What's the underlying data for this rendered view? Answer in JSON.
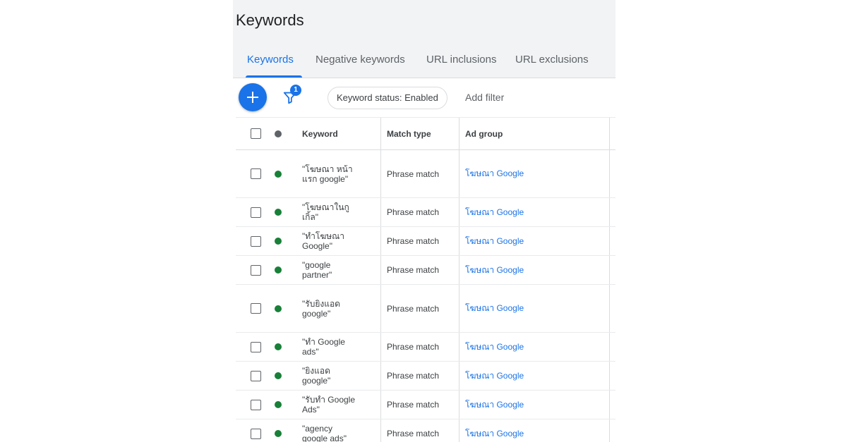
{
  "header": {
    "title": "Keywords",
    "tabs": [
      {
        "label": "Keywords",
        "active": true
      },
      {
        "label": "Negative keywords",
        "active": false
      },
      {
        "label": "URL inclusions",
        "active": false
      },
      {
        "label": "URL exclusions",
        "active": false
      }
    ]
  },
  "toolbar": {
    "add_icon": "plus-icon",
    "filter_icon": "filter-icon",
    "filter_count": "1",
    "status_chip": "Keyword status: Enabled",
    "add_filter": "Add filter"
  },
  "table": {
    "columns": [
      "Keyword",
      "Match type",
      "Ad group"
    ],
    "status_header_color": "#5f6368",
    "enabled_color": "#188038",
    "rows": [
      {
        "keyword_line1": "\"โฆษณา หน้า",
        "keyword_line2": "แรก google\"",
        "match_type": "Phrase match",
        "ad_group": "โฆษณา Google"
      },
      {
        "keyword_line1": "\"โฆษณาในกู",
        "keyword_line2": "เกิ้ล\"",
        "match_type": "Phrase match",
        "ad_group": "โฆษณา Google"
      },
      {
        "keyword_line1": "\"ทำโฆษณา",
        "keyword_line2": "Google\"",
        "match_type": "Phrase match",
        "ad_group": "โฆษณา Google"
      },
      {
        "keyword_line1": "\"google",
        "keyword_line2": "partner\"",
        "match_type": "Phrase match",
        "ad_group": "โฆษณา Google"
      },
      {
        "keyword_line1": "\"รับยิงแอด",
        "keyword_line2": "google\"",
        "match_type": "Phrase match",
        "ad_group": "โฆษณา Google"
      },
      {
        "keyword_line1": "\"ทำ Google",
        "keyword_line2": "ads\"",
        "match_type": "Phrase match",
        "ad_group": "โฆษณา Google"
      },
      {
        "keyword_line1": "\"ยิงแอด",
        "keyword_line2": "google\"",
        "match_type": "Phrase match",
        "ad_group": "โฆษณา Google"
      },
      {
        "keyword_line1": "\"รับทำ Google",
        "keyword_line2": "Ads\"",
        "match_type": "Phrase match",
        "ad_group": "โฆษณา Google"
      },
      {
        "keyword_line1": "\"agency",
        "keyword_line2": "google ads\"",
        "match_type": "Phrase match",
        "ad_group": "โฆษณา Google"
      }
    ]
  }
}
